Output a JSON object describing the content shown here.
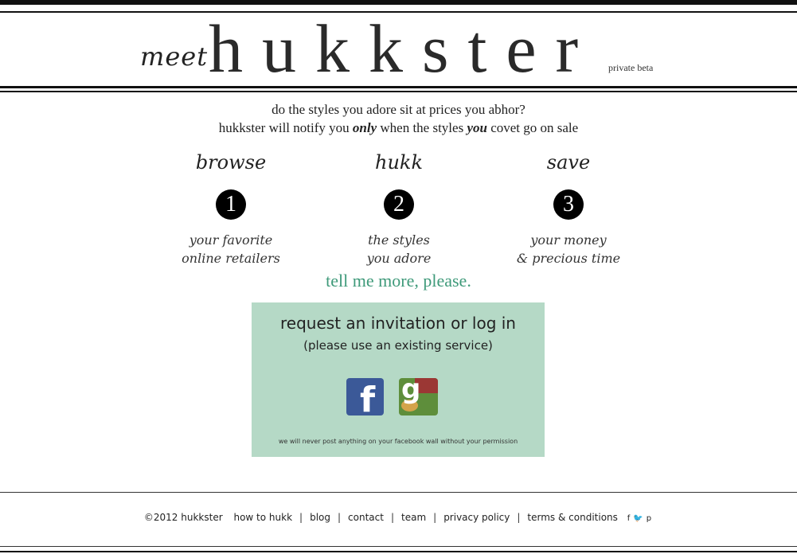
{
  "header": {
    "meet": "meet",
    "brand": "hukkster",
    "beta": "private beta"
  },
  "tagline": {
    "line1": "do the styles you adore sit at prices you abhor?",
    "line2_a": "hukkster will notify you ",
    "line2_only": "only",
    "line2_b": " when the styles ",
    "line2_you": "you",
    "line2_c": " covet go on sale"
  },
  "steps": [
    {
      "title": "browse",
      "number": "1",
      "desc1": "your favorite",
      "desc2": "online retailers"
    },
    {
      "title": "hukk",
      "number": "2",
      "desc1": "the styles",
      "desc2": "you adore"
    },
    {
      "title": "save",
      "number": "3",
      "desc1": "your money",
      "desc2": "& precious time"
    }
  ],
  "more_link": "tell me more, please.",
  "invite": {
    "title": "request an invitation or log in",
    "subtitle": "(please use an existing service)",
    "facebook_icon": "facebook-icon",
    "facebook_glyph": "f",
    "google_icon": "google-icon",
    "google_glyph": "g",
    "disclaimer": "we will never post anything on your facebook wall without your permission",
    "bg_color": "#b5d9c6"
  },
  "footer": {
    "copyright": "©2012 hukkster",
    "links": [
      "how to hukk",
      "blog",
      "contact",
      "team",
      "privacy policy",
      "terms & conditions"
    ],
    "social": [
      "f",
      "🐦",
      "p"
    ]
  },
  "colors": {
    "accent": "#3f9a7a",
    "facebook": "#3b5998"
  }
}
